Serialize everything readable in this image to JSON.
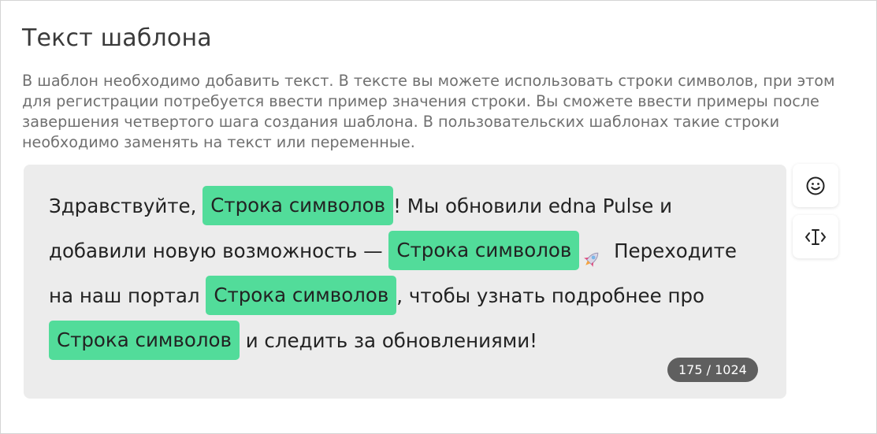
{
  "section": {
    "title": "Текст шаблона",
    "description": "В шаблон необходимо добавить текст. В тексте вы можете использовать строки символов, при этом для регистрации потребуется ввести пример значения строки. Вы сможете ввести примеры после завершения четвертого шага создания шаблона. В пользовательских шаблонах такие строки необходимо заменять на текст или переменные."
  },
  "editor": {
    "parts": {
      "t1": "Здравствуйте, ",
      "chip1": "Строка символов",
      "t2": "! Мы обновили edna Pulse и добавили новую возможность — ",
      "chip2": "Строка символов",
      "t3": " Переходите на наш портал ",
      "chip3": "Строка символов",
      "t4": ", чтобы узнать подробнее про ",
      "chip4": "Строка символов",
      "t5": " и следить за обновлениями!"
    },
    "counter": "175 / 1024",
    "chip_color": "#52dc9a"
  },
  "toolbar": {
    "emoji_icon": "smiley-face-icon",
    "variable_icon": "text-cursor-insert-icon"
  }
}
